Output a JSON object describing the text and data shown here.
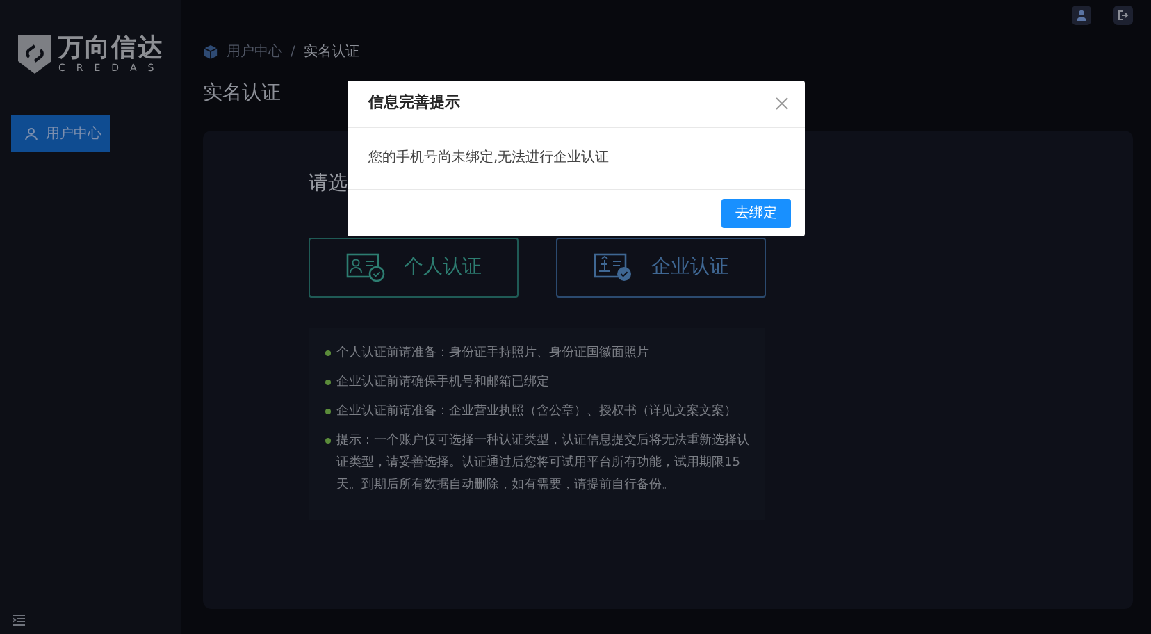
{
  "logo": {
    "name": "万向信达",
    "tagline": "CREDAS"
  },
  "sidebar": {
    "items": [
      {
        "label": "用户中心",
        "selected": true
      }
    ]
  },
  "breadcrumb": [
    "用户中心",
    "实名认证"
  ],
  "breadcrumb_separator": "/",
  "page_title": "实名认证",
  "prompt": "请选",
  "options": [
    {
      "label": "个人认证",
      "kind": "personal"
    },
    {
      "label": "企业认证",
      "kind": "enterprise"
    }
  ],
  "notes": [
    "个人认证前请准备：身份证手持照片、身份证国徽面照片",
    "企业认证前请确保手机号和邮箱已绑定",
    "企业认证前请准备：企业营业执照（含公章）、授权书（详见文案文案）",
    "提示：一个账户仅可选择一种认证类型，认证信息提交后将无法重新选择认证类型，请妥善选择。认证通过后您将可试用平台所有功能，试用期限15天。到期后所有数据自动删除，如有需要，请提前自行备份。"
  ],
  "modal": {
    "title": "信息完善提示",
    "message": "您的手机号尚未绑定,无法进行企业认证",
    "button": "去绑定"
  }
}
